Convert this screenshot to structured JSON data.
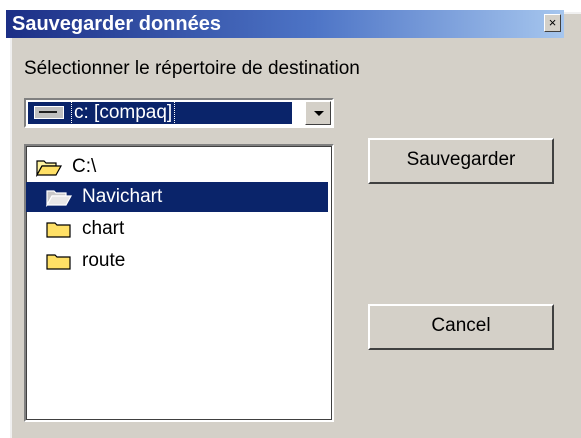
{
  "window": {
    "title": "Sauvegarder données",
    "close_glyph": "×",
    "title_gradient": [
      "#1c2f86",
      "#a6c6ee"
    ]
  },
  "prompt": "Sélectionner le répertoire de destination",
  "drive": {
    "selected": "c: [compaq]",
    "icon": "drive-icon",
    "highlight_color": "#0a246a"
  },
  "folders": [
    {
      "label": "C:\\",
      "icon": "open-folder-icon",
      "selected": false
    },
    {
      "label": "Navichart",
      "icon": "open-folder-icon",
      "selected": true
    },
    {
      "label": "chart",
      "icon": "folder-icon",
      "selected": false
    },
    {
      "label": "route",
      "icon": "folder-icon",
      "selected": false
    }
  ],
  "buttons": {
    "save_label": "Sauvegarder",
    "cancel_label": "Cancel"
  }
}
